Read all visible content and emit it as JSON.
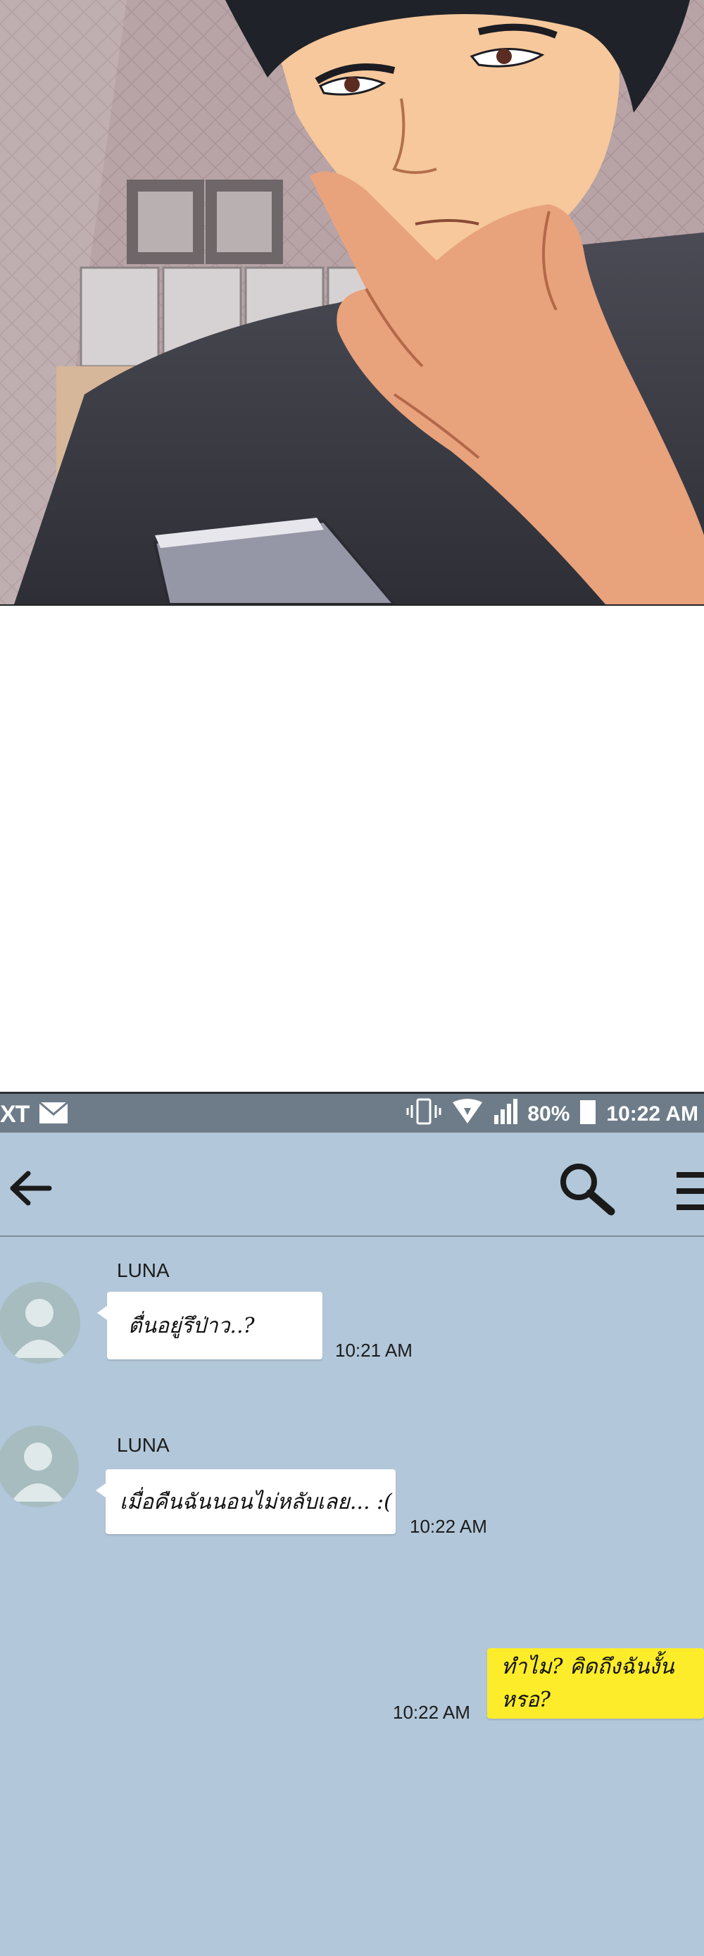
{
  "status_bar": {
    "carrier": "XT",
    "icons": [
      "mail-icon",
      "vibrate-icon",
      "wifi-icon",
      "signal-icon",
      "battery-icon"
    ],
    "battery": "80%",
    "time": "10:22 AM"
  },
  "app_bar": {
    "icons": [
      "back-arrow-icon",
      "search-icon",
      "menu-icon"
    ]
  },
  "messages": [
    {
      "sender": "LUNA",
      "text": "ตื่นอยู่รึป่าว..?",
      "time": "10:21 AM"
    },
    {
      "sender": "LUNA",
      "text": "เมื่อคืนฉันนอนไม่หลับเลย... :(",
      "time": "10:22 AM"
    },
    {
      "sender": "",
      "text": "ทำไม? คิดถึงฉันงั้นหรอ?",
      "time": "10:22 AM",
      "mine": true
    }
  ],
  "colors": {
    "chat_background": "#b2c7d9",
    "status_bar": "#6e7c89",
    "own_bubble": "#fcec2a",
    "incoming_bubble": "#ffffff"
  }
}
